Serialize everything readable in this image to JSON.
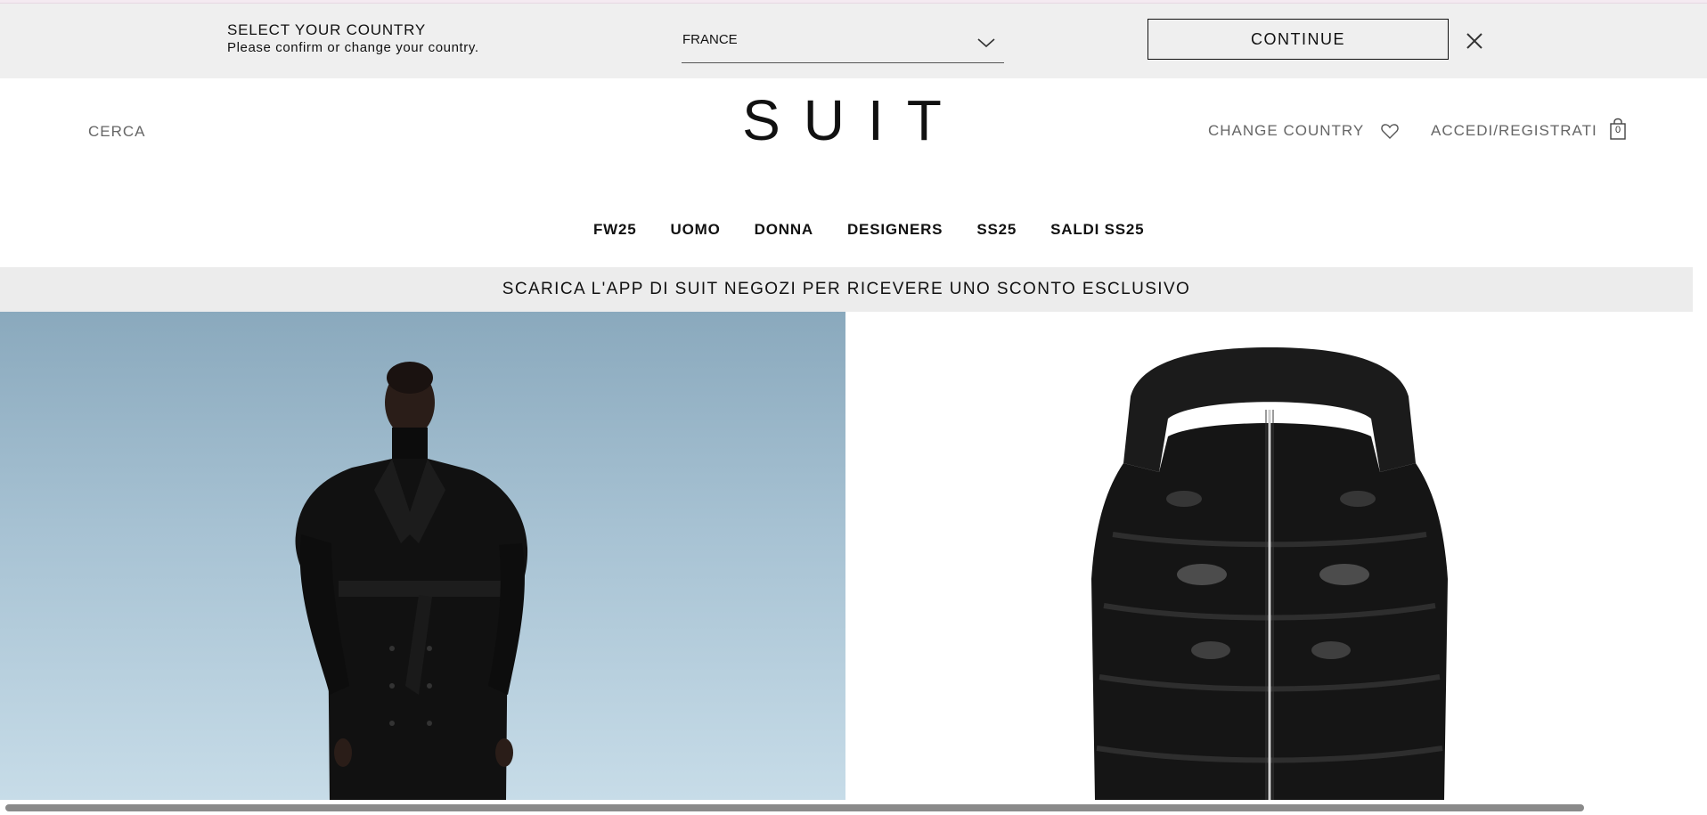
{
  "country_bar": {
    "title": "SELECT YOUR COUNTRY",
    "subtitle": "Please confirm or change your country.",
    "selected_country": "FRANCE",
    "continue_label": "CONTINUE"
  },
  "header": {
    "search_label": "CERCA",
    "logo_text": "SUIT",
    "change_country_label": "CHANGE COUNTRY",
    "account_label": "ACCEDI/REGISTRATI",
    "cart_count": "0"
  },
  "nav": {
    "items": [
      "FW25",
      "UOMO",
      "DONNA",
      "DESIGNERS",
      "SS25",
      "SALDI SS25"
    ]
  },
  "promo": {
    "text": "SCARICA L'APP DI SUIT NEGOZI PER RICEVERE UNO SCONTO ESCLUSIVO"
  },
  "icons": {
    "chevron": "chevron-down-icon",
    "close": "close-icon",
    "wishlist": "heart-icon",
    "cart": "shopping-bag-icon"
  },
  "colors": {
    "country_bar_bg": "#efefef",
    "promo_bg": "#ececec",
    "text": "#111111",
    "muted_text": "#666666",
    "hero_sky": "#a7c2d3"
  }
}
